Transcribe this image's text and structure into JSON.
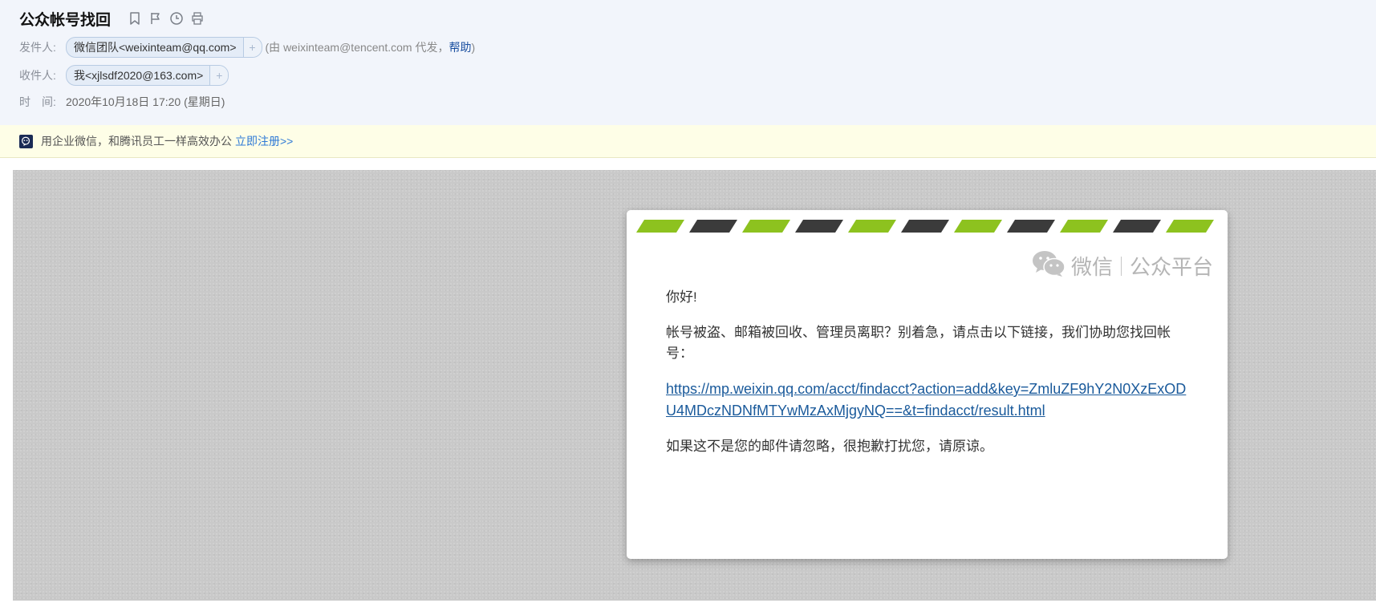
{
  "header": {
    "subject": "公众帐号找回",
    "icons": [
      "bookmark-icon",
      "flag-icon",
      "clock-icon",
      "print-icon"
    ],
    "from": {
      "label": "发件人:",
      "contact": "微信团队<weixinteam@qq.com>",
      "add": "+",
      "proxy_prefix": "(由 weixinteam@tencent.com 代发，",
      "help": "帮助",
      "proxy_suffix": ")"
    },
    "to": {
      "label": "收件人:",
      "contact": "我<xjlsdf2020@163.com>",
      "add": "+"
    },
    "time": {
      "label": "时　间:",
      "value": "2020年10月18日 17:20 (星期日)"
    }
  },
  "banner": {
    "icon": "work-weixin-icon",
    "text": "用企业微信，和腾讯员工一样高效办公",
    "link": "立即注册>>"
  },
  "email": {
    "brand_left": "微信",
    "brand_right": "公众平台",
    "greeting": "你好!",
    "paragraph": "帐号被盗、邮箱被回收、管理员离职？别着急，请点击以下链接，我们协助您找回帐号：",
    "link": "https://mp.weixin.qq.com/acct/findacct?action=add&key=ZmluZF9hY2N0XzExODU4MDczNDNfMTYwMzAxMjgyNQ==&t=findacct/result.html",
    "closing": "如果这不是您的邮件请忽略，很抱歉打扰您，请原谅。"
  },
  "colors": {
    "header_bg": "#f2f5fb",
    "banner_bg": "#fefee7",
    "stripe_green": "#8dc21f",
    "stripe_dark": "#3b3b3b",
    "link": "#1a5a9b"
  }
}
